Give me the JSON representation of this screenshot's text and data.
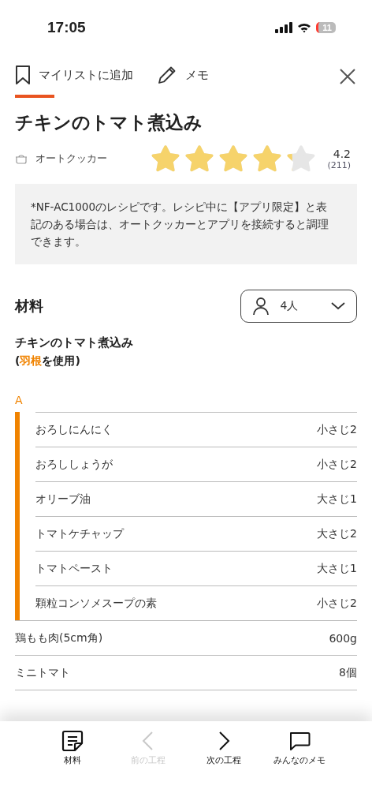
{
  "status_bar": {
    "time": "17:05",
    "battery": "11"
  },
  "tabs": [
    {
      "label": "マイリストに追加",
      "selected": true
    },
    {
      "label": "メモ",
      "selected": false
    }
  ],
  "recipe": {
    "title": "チキンのトマト煮込み",
    "appliance": "オートクッカー",
    "stars": 4.2,
    "rating": "4.2",
    "reviews": "(211)"
  },
  "note": "*NF-AC1000のレシピです。レシピ中に【アプリ限定】と表記のある場合は、オートクッカーとアプリを接続すると調理できます。",
  "ingredients": {
    "heading": "材料",
    "servings": "4人",
    "dish": "チキンのトマト煮込み",
    "usage": [
      {
        "text": "(",
        "highlight": false
      },
      {
        "text": "羽根",
        "highlight": true
      },
      {
        "text": "を使用)",
        "highlight": false
      }
    ],
    "groups": [
      {
        "label": "A",
        "items": [
          {
            "name": "おろしにんにく",
            "amount": "小さじ2"
          },
          {
            "name": "おろししょうが",
            "amount": "小さじ2"
          },
          {
            "name": "オリーブ油",
            "amount": "大さじ1"
          },
          {
            "name": "トマトケチャップ",
            "amount": "大さじ2"
          },
          {
            "name": "トマトペースト",
            "amount": "大さじ1"
          },
          {
            "name": "顆粒コンソメスープの素",
            "amount": "小さじ2"
          }
        ]
      }
    ],
    "items": [
      {
        "name": "鶏もも肉(5cm角)",
        "amount": "600g"
      },
      {
        "name": "ミニトマト",
        "amount": "8個"
      }
    ]
  },
  "bottom_nav": [
    {
      "label": "材料",
      "disabled": false
    },
    {
      "label": "前の工程",
      "disabled": true
    },
    {
      "label": "次の工程",
      "disabled": false
    },
    {
      "label": "みんなのメモ",
      "disabled": false
    }
  ]
}
